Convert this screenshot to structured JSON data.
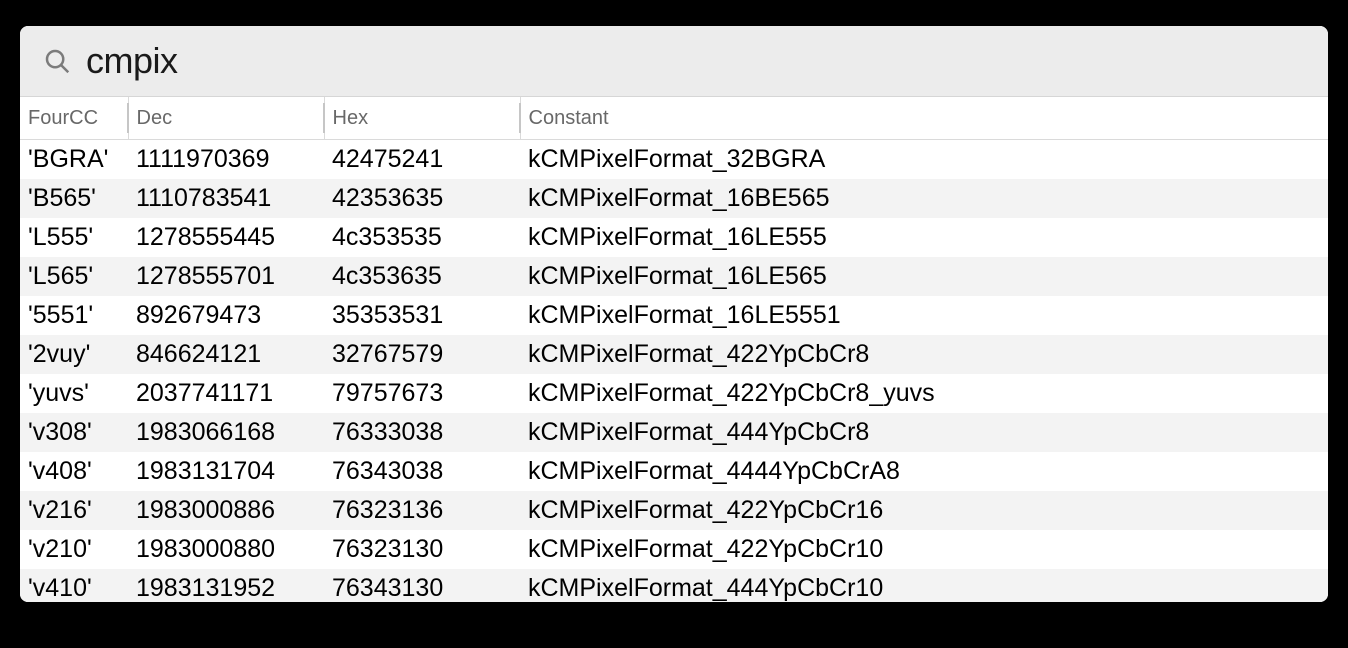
{
  "search": {
    "value": "cmpix"
  },
  "columns": {
    "fourcc": "FourCC",
    "dec": "Dec",
    "hex": "Hex",
    "constant": "Constant"
  },
  "rows": [
    {
      "fourcc": "'BGRA'",
      "dec": "1111970369",
      "hex": "42475241",
      "constant": "kCMPixelFormat_32BGRA"
    },
    {
      "fourcc": "'B565'",
      "dec": "1110783541",
      "hex": "42353635",
      "constant": "kCMPixelFormat_16BE565"
    },
    {
      "fourcc": "'L555'",
      "dec": "1278555445",
      "hex": "4c353535",
      "constant": "kCMPixelFormat_16LE555"
    },
    {
      "fourcc": "'L565'",
      "dec": "1278555701",
      "hex": "4c353635",
      "constant": "kCMPixelFormat_16LE565"
    },
    {
      "fourcc": "'5551'",
      "dec": "892679473",
      "hex": "35353531",
      "constant": "kCMPixelFormat_16LE5551"
    },
    {
      "fourcc": "'2vuy'",
      "dec": "846624121",
      "hex": "32767579",
      "constant": "kCMPixelFormat_422YpCbCr8"
    },
    {
      "fourcc": "'yuvs'",
      "dec": "2037741171",
      "hex": "79757673",
      "constant": "kCMPixelFormat_422YpCbCr8_yuvs"
    },
    {
      "fourcc": "'v308'",
      "dec": "1983066168",
      "hex": "76333038",
      "constant": "kCMPixelFormat_444YpCbCr8"
    },
    {
      "fourcc": "'v408'",
      "dec": "1983131704",
      "hex": "76343038",
      "constant": "kCMPixelFormat_4444YpCbCrA8"
    },
    {
      "fourcc": "'v216'",
      "dec": "1983000886",
      "hex": "76323136",
      "constant": "kCMPixelFormat_422YpCbCr16"
    },
    {
      "fourcc": "'v210'",
      "dec": "1983000880",
      "hex": "76323130",
      "constant": "kCMPixelFormat_422YpCbCr10"
    },
    {
      "fourcc": "'v410'",
      "dec": "1983131952",
      "hex": "76343130",
      "constant": "kCMPixelFormat_444YpCbCr10"
    }
  ]
}
